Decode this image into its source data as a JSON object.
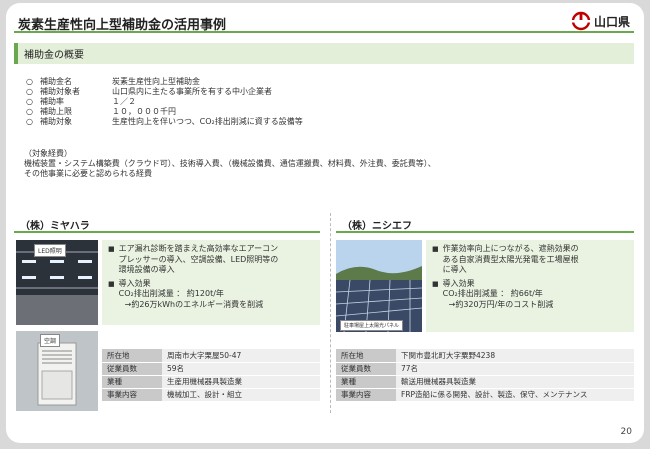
{
  "title": "炭素生産性向上型補助金の活用事例",
  "logo_text": "山口県",
  "overview": {
    "heading": "補助金の概要",
    "rows": [
      {
        "bullet": "○",
        "label": "補助金名",
        "value": "炭素生産性向上型補助金"
      },
      {
        "bullet": "○",
        "label": "補助対象者",
        "value": "山口県内に主たる事業所を有する中小企業者"
      },
      {
        "bullet": "○",
        "label": "補助率",
        "value": "１／２"
      },
      {
        "bullet": "○",
        "label": "補助上限",
        "value": "１０，０００千円"
      },
      {
        "bullet": "○",
        "label": "補助対象",
        "value": "生産性向上を伴いつつ、CO₂排出削減に資する設備等"
      }
    ],
    "cost_title": "（対象経費）",
    "cost_line1": "機械装置・システム構築費（クラウド可）、技術導入費、（機械設備費、通信運搬費、材料費、外注費、委託費等）、",
    "cost_line2": "その他事業に必要と認められる経費"
  },
  "companies": [
    {
      "name": "（株）ミヤハラ",
      "photo1_label": "LED照明",
      "photo2_label": "空調",
      "effect1_line1": "エア漏れ診断を踏まえた高効率なエアーコン",
      "effect1_line2": "プレッサーの導入、空調設備、LED照明等の",
      "effect1_line3": "環境設備の導入",
      "effect2_title": "導入効果",
      "effect2_line1": "CO₂排出削減量 ： 約120t/年",
      "effect2_line2": "→約26万kWhのエネルギー消費を削減",
      "table": [
        {
          "k": "所在地",
          "v": "周南市大字栗屋50-47"
        },
        {
          "k": "従業員数",
          "v": "59名"
        },
        {
          "k": "業種",
          "v": "生産用機械器具製造業"
        },
        {
          "k": "事業内容",
          "v": "機械加工、設計・組立"
        }
      ]
    },
    {
      "name": "（株）ニシエフ",
      "photo1_label": "駐車場屋上太陽光パネル",
      "effect1_line1": "作業効率向上につながる、遮熱効果の",
      "effect1_line2": "ある自家消費型太陽光発電を工場屋根",
      "effect1_line3": "に導入",
      "effect2_title": "導入効果",
      "effect2_line1": "CO₂排出削減量 ： 約66t/年",
      "effect2_line2": "→約320万円/年のコスト削減",
      "table": [
        {
          "k": "所在地",
          "v": "下関市豊北町大字粟野4238"
        },
        {
          "k": "従業員数",
          "v": "77名"
        },
        {
          "k": "業種",
          "v": "輸送用機械器具製造業"
        },
        {
          "k": "事業内容",
          "v": "FRP造船に係る開発、設計、製造、保守、メンテナンス"
        }
      ]
    }
  ],
  "page_number": "20",
  "colors": {
    "accent": "#6aa84f",
    "effect_bg": "#eaf3e2",
    "section_bg": "#e3efd9"
  }
}
